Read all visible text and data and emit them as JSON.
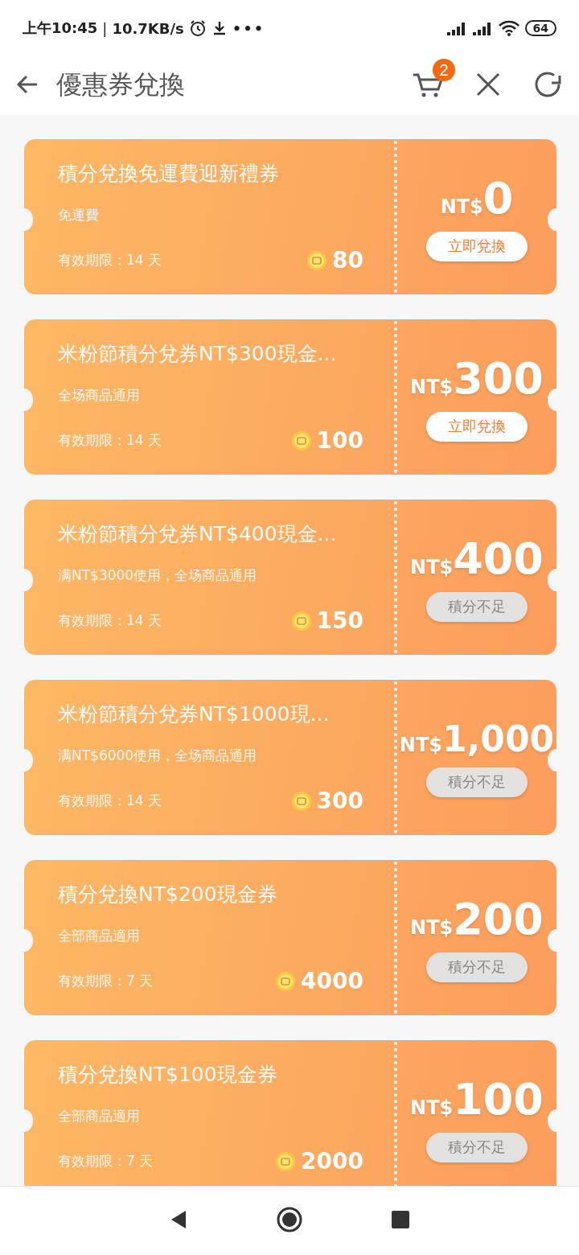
{
  "status_bar": {
    "time": "上午10:45",
    "divider": "|",
    "speed": "10.7KB/s",
    "more": "•••",
    "battery": "64"
  },
  "header": {
    "title": "優惠券兌換",
    "cart_count": "2"
  },
  "coupons": [
    {
      "title": "積分兌換免運費迎新禮券",
      "condition": "免運費",
      "validity": "有效期限：14 天",
      "points": "80",
      "currency": "NT$",
      "amount": "0",
      "button": "立即兌換",
      "disabled": false
    },
    {
      "title": "米粉節積分兌券NT$300現金...",
      "condition": "全场商品通用",
      "validity": "有效期限：14 天",
      "points": "100",
      "currency": "NT$",
      "amount": "300",
      "button": "立即兌換",
      "disabled": false
    },
    {
      "title": "米粉節積分兌券NT$400現金...",
      "condition": "满NT$3000使用，全场商品通用",
      "validity": "有效期限：14 天",
      "points": "150",
      "currency": "NT$",
      "amount": "400",
      "button": "積分不足",
      "disabled": true
    },
    {
      "title": "米粉節積分兌券NT$1000現...",
      "condition": "满NT$6000使用，全场商品通用",
      "validity": "有效期限：14 天",
      "points": "300",
      "currency": "NT$",
      "amount": "1,000",
      "button": "積分不足",
      "disabled": true
    },
    {
      "title": "積分兌換NT$200現金券",
      "condition": "全部商品適用",
      "validity": "有效期限：7 天",
      "points": "4000",
      "currency": "NT$",
      "amount": "200",
      "button": "積分不足",
      "disabled": true
    },
    {
      "title": "積分兌換NT$100現金券",
      "condition": "全部商品適用",
      "validity": "有效期限：7 天",
      "points": "2000",
      "currency": "NT$",
      "amount": "100",
      "button": "積分不足",
      "disabled": true
    }
  ]
}
